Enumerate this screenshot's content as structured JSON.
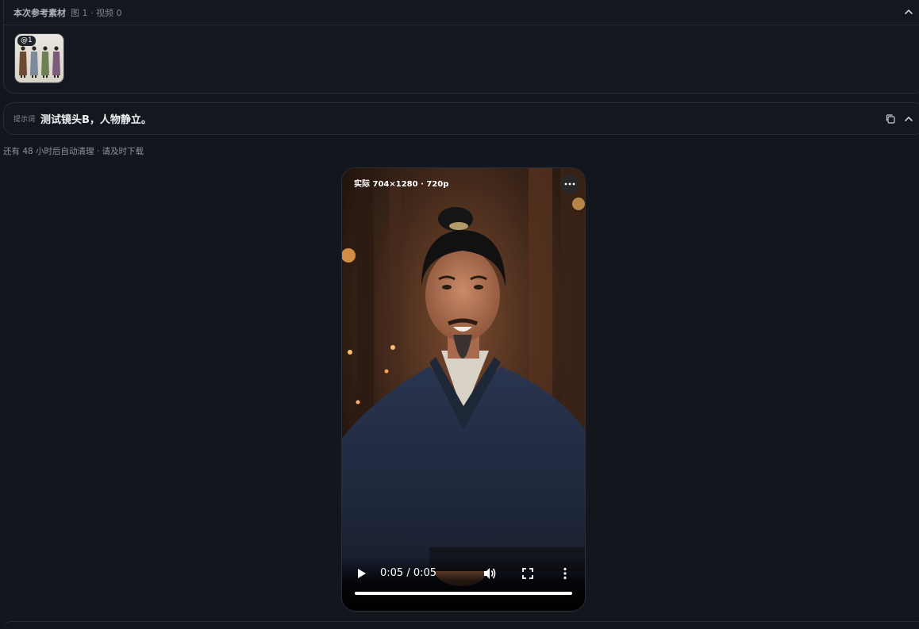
{
  "reference": {
    "title": "本次参考素材",
    "count": "图 1 · 视频 0",
    "thumbnail_badge": "@1"
  },
  "prompt": {
    "label": "提示词",
    "text": "测试镜头B，人物静立。"
  },
  "expiry_notice": "还有 48 小时后自动清理 · 请及时下载",
  "video": {
    "resolution_label": "实际 704×1280 · 720p",
    "time": "0:05 / 0:05",
    "progress": 1.0
  },
  "icons": {
    "collapse": "chevron-up-icon",
    "copy": "copy-icon",
    "more": "more-horizontal-icon",
    "play": "play-icon",
    "volume": "volume-icon",
    "fullscreen": "fullscreen-icon",
    "menu": "more-vertical-icon"
  },
  "colors": {
    "background": "#13161d",
    "panel_border": "#262b35",
    "text_primary": "#eef0f4",
    "text_muted": "#8d939e"
  }
}
